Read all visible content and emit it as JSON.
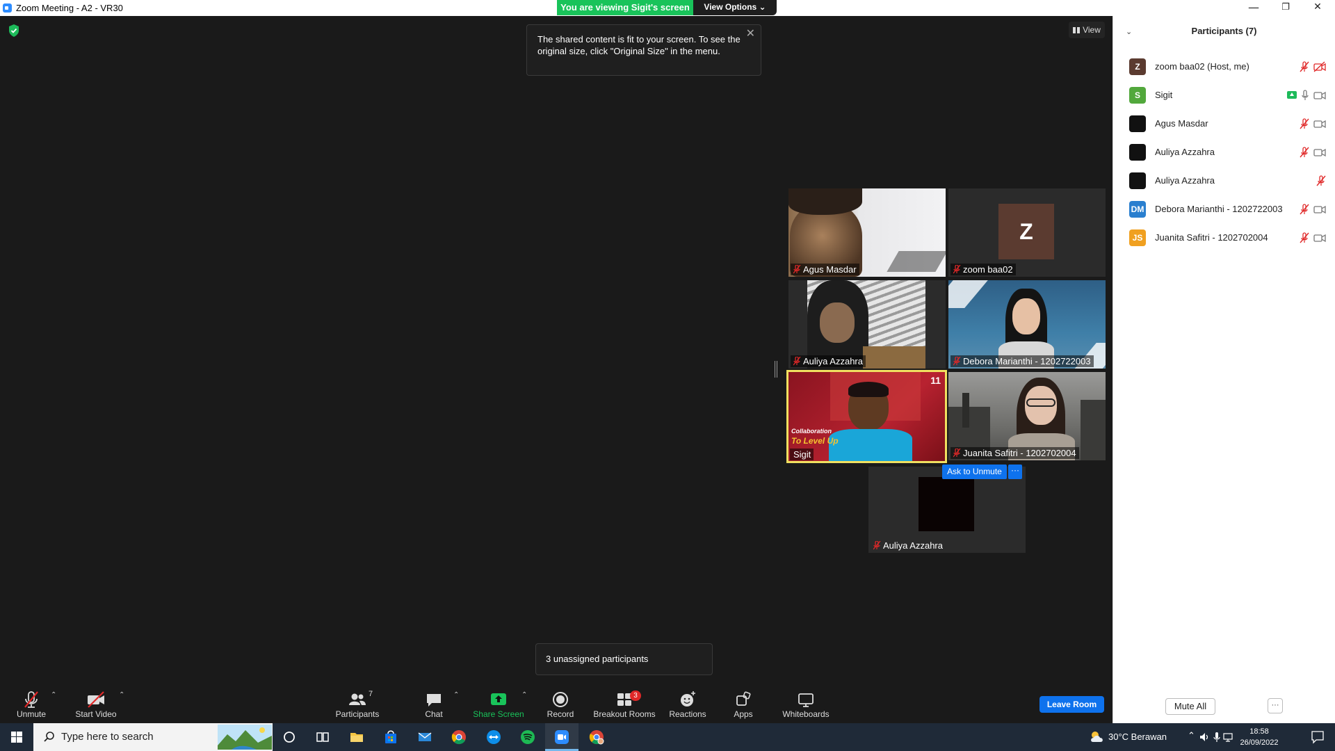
{
  "window": {
    "title": "Zoom Meeting - A2 - VR30",
    "minimize": "—",
    "restore": "❐",
    "close": "✕"
  },
  "banner": {
    "viewing_text": "You are viewing Sigit's screen",
    "view_options_label": "View Options ⌄"
  },
  "view_button": {
    "label": "View"
  },
  "tooltip": {
    "text": "The shared content is fit to your screen. To see the original size, click \"Original Size\" in the menu.",
    "close": "✕"
  },
  "tiles": [
    {
      "name": "Agus Masdar"
    },
    {
      "name": "zoom baa02",
      "avatar": "Z"
    },
    {
      "name": "Auliya Azzahra"
    },
    {
      "name": "Debora Marianthi - 1202722003"
    },
    {
      "name": "Sigit"
    },
    {
      "name": "Juanita Safitri - 1202702004"
    },
    {
      "name": "Auliya Azzahra"
    }
  ],
  "ask_to_unmute": "Ask to Unmute",
  "ask_more": "···",
  "unassigned_notice": "3 unassigned participants",
  "toolbar": {
    "unmute": "Unmute",
    "start_video": "Start Video",
    "participants": "Participants",
    "participants_count": "7",
    "chat": "Chat",
    "share_screen": "Share Screen",
    "record": "Record",
    "breakout_rooms": "Breakout Rooms",
    "breakout_badge": "3",
    "reactions": "Reactions",
    "apps": "Apps",
    "whiteboards": "Whiteboards",
    "leave_room": "Leave Room",
    "caret": "⌃"
  },
  "panel": {
    "title": "Participants (7)",
    "participants": [
      {
        "initials": "Z",
        "name": "zoom baa02 (Host, me)",
        "color": "#5b3b30"
      },
      {
        "initials": "S",
        "name": "Sigit",
        "color": "#52a83c"
      },
      {
        "initials": "",
        "name": "Agus Masdar",
        "color": "#111111"
      },
      {
        "initials": "",
        "name": "Auliya Azzahra",
        "color": "#111111"
      },
      {
        "initials": "",
        "name": "Auliya Azzahra",
        "color": "#111111"
      },
      {
        "initials": "DM",
        "name": "Debora Marianthi - 1202722003",
        "color": "#2a7fcf"
      },
      {
        "initials": "JS",
        "name": "Juanita Safitri - 1202702004",
        "color": "#f0a020"
      }
    ],
    "mute_all": "Mute All",
    "more": "···"
  },
  "taskbar": {
    "search_placeholder": "Type here to search",
    "weather": "30°C  Berawan",
    "time": "18:58",
    "date": "26/09/2022"
  },
  "colors": {
    "zoom_blue": "#0e72ed",
    "share_green": "#19c35a",
    "mute_red": "#e02828"
  }
}
